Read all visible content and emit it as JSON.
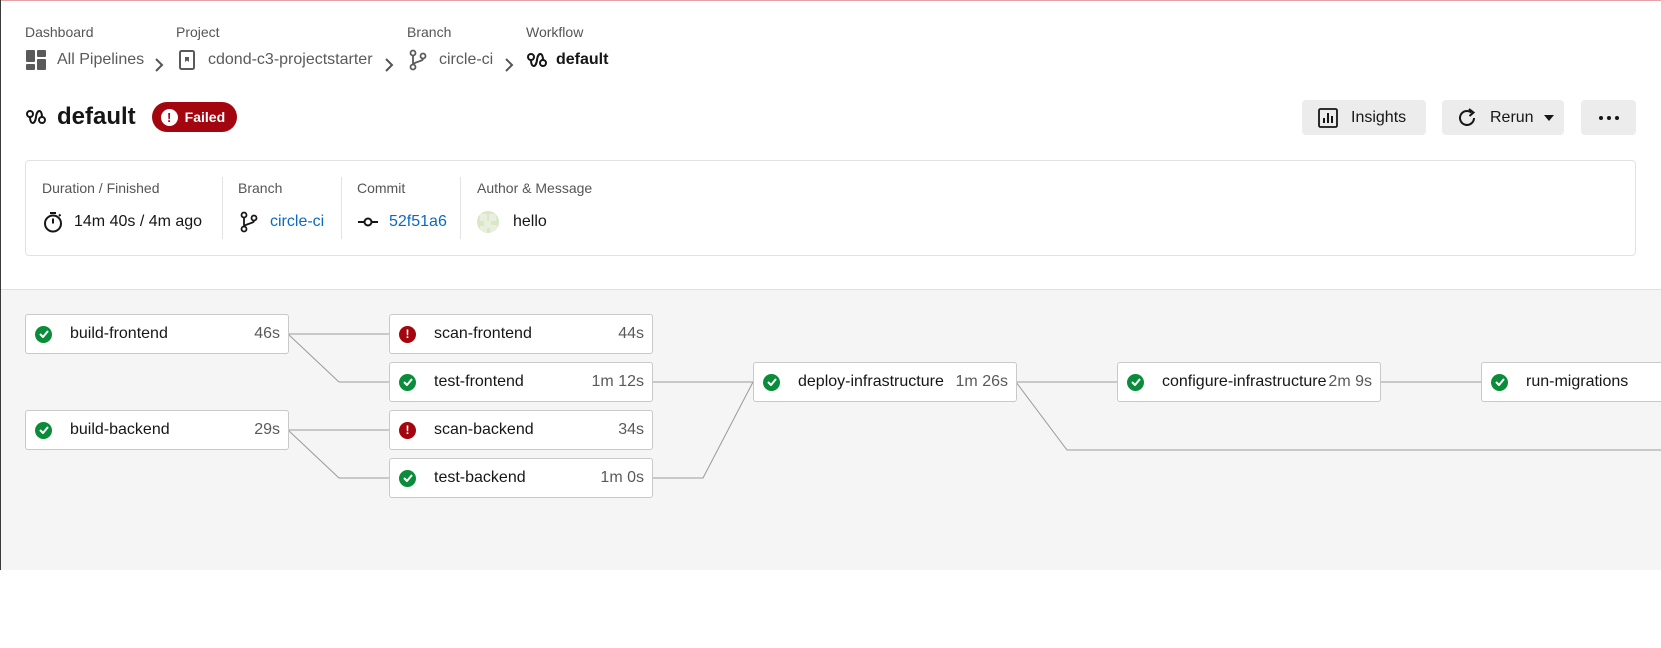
{
  "breadcrumbs": [
    {
      "label": "Dashboard",
      "value": "All Pipelines",
      "icon": "grid-icon"
    },
    {
      "label": "Project",
      "value": "cdond-c3-projectstarter",
      "icon": "repo-icon"
    },
    {
      "label": "Branch",
      "value": "circle-ci",
      "icon": "branch-icon"
    },
    {
      "label": "Workflow",
      "value": "default",
      "icon": "workflow-icon"
    }
  ],
  "header": {
    "title": "default",
    "status": "Failed",
    "status_color": "#a3060f"
  },
  "actions": {
    "insights": "Insights",
    "rerun": "Rerun"
  },
  "summary": {
    "duration_label": "Duration / Finished",
    "duration_value": "14m 40s / 4m ago",
    "branch_label": "Branch",
    "branch_value": "circle-ci",
    "commit_label": "Commit",
    "commit_value": "52f51a6",
    "author_label": "Author & Message",
    "author_message": "hello"
  },
  "colors": {
    "success": "#0a8c3a",
    "failed": "#a3060f",
    "link": "#0a6bc2"
  },
  "jobs": [
    {
      "name": "build-frontend",
      "duration": "46s",
      "status": "success"
    },
    {
      "name": "build-backend",
      "duration": "29s",
      "status": "success"
    },
    {
      "name": "scan-frontend",
      "duration": "44s",
      "status": "failed"
    },
    {
      "name": "test-frontend",
      "duration": "1m 12s",
      "status": "success"
    },
    {
      "name": "scan-backend",
      "duration": "34s",
      "status": "failed"
    },
    {
      "name": "test-backend",
      "duration": "1m 0s",
      "status": "success"
    },
    {
      "name": "deploy-infrastructure",
      "duration": "1m 26s",
      "status": "success"
    },
    {
      "name": "configure-infrastructure",
      "duration": "2m 9s",
      "status": "success"
    },
    {
      "name": "run-migrations",
      "duration": "",
      "status": "success"
    }
  ]
}
